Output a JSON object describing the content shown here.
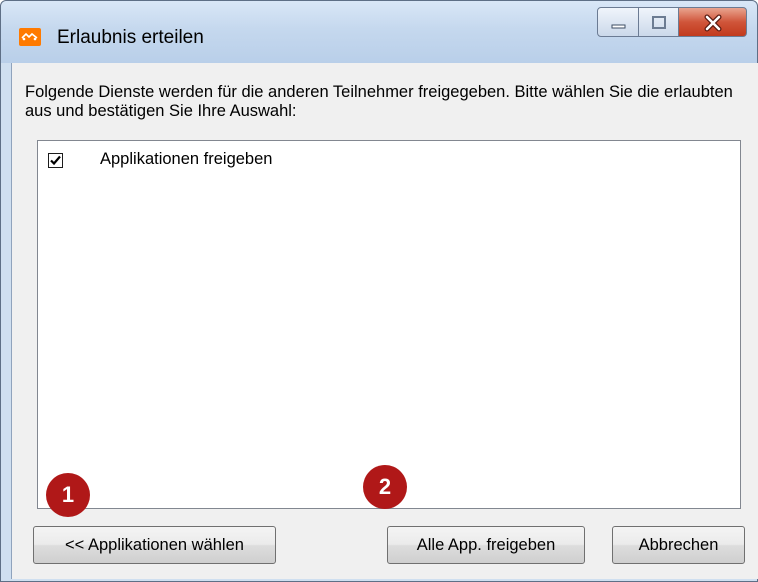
{
  "window": {
    "title": "Erlaubnis erteilen",
    "icon": "app-icon-orange",
    "controls": [
      "minimize-icon",
      "maximize-icon",
      "close-icon"
    ]
  },
  "dialog": {
    "description": "Folgende Dienste werden für die anderen Teilnehmer freigegeben. Bitte wählen Sie die erlaubten aus und bestätigen Sie Ihre Auswahl:",
    "services": [
      {
        "label": "Applikationen freigeben",
        "checked": true
      }
    ]
  },
  "buttons": {
    "back": "<< Applikationen wählen",
    "share_all": "Alle App. freigeben",
    "cancel": "Abbrechen"
  },
  "markers": {
    "first": "1",
    "second": "2",
    "color": "#b01818"
  }
}
